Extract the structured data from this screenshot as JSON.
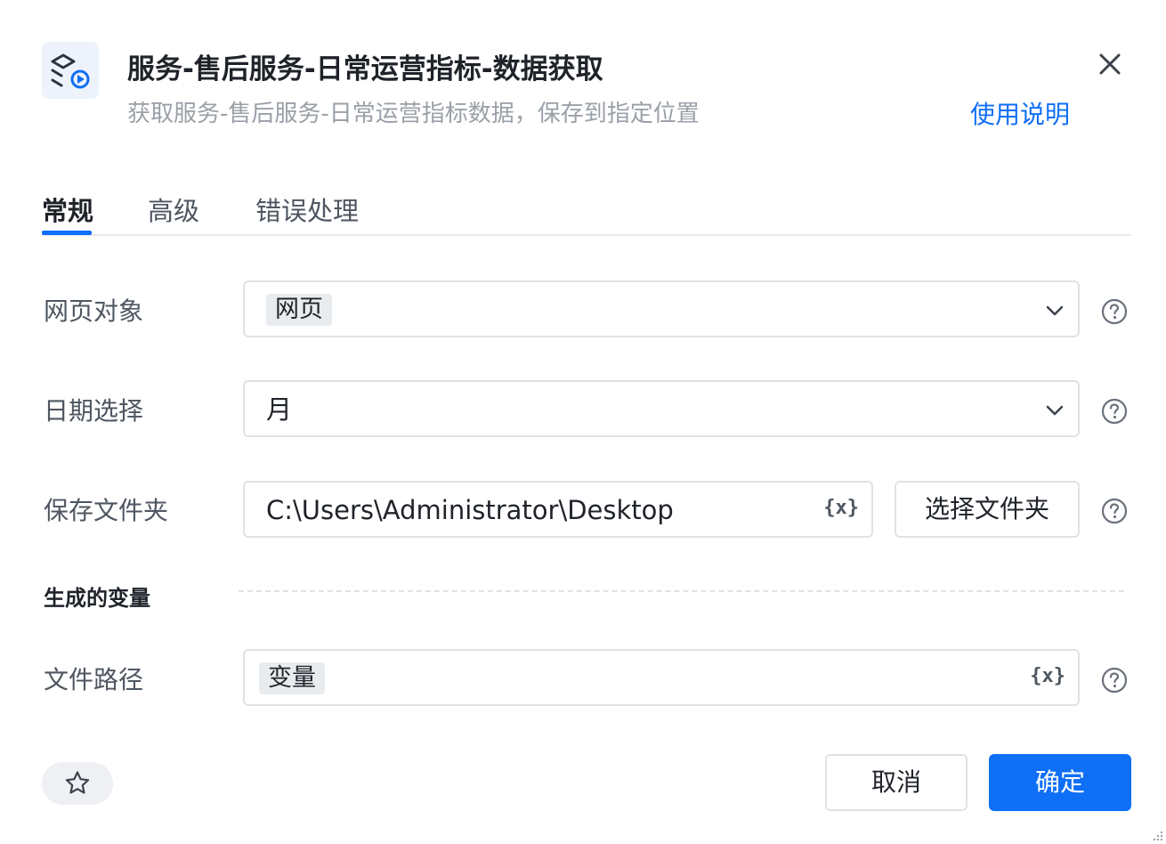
{
  "header": {
    "app_icon": "workflow-play-icon",
    "title": "服务-售后服务-日常运营指标-数据获取",
    "subtitle": "获取服务-售后服务-日常运营指标数据，保存到指定位置",
    "help_link": "使用说明",
    "close_icon": "close-icon"
  },
  "tabs": [
    {
      "label": "常规",
      "active": true
    },
    {
      "label": "高级",
      "active": false
    },
    {
      "label": "错误处理",
      "active": false
    }
  ],
  "form": {
    "web_object": {
      "label": "网页对象",
      "value": "网页"
    },
    "date_select": {
      "label": "日期选择",
      "value": "月"
    },
    "save_folder": {
      "label": "保存文件夹",
      "value": "C:\\Users\\Administrator\\Desktop",
      "button": "选择文件夹"
    },
    "var_icon_text": "{x}"
  },
  "generated_vars": {
    "section_label": "生成的变量",
    "file_path": {
      "label": "文件路径",
      "value": "变量"
    }
  },
  "footer": {
    "favorite_icon": "star-icon",
    "cancel": "取消",
    "confirm": "确定"
  },
  "colors": {
    "accent": "#0f6ff6",
    "border": "#dfe2e6",
    "muted_text": "#9aa0a8"
  }
}
